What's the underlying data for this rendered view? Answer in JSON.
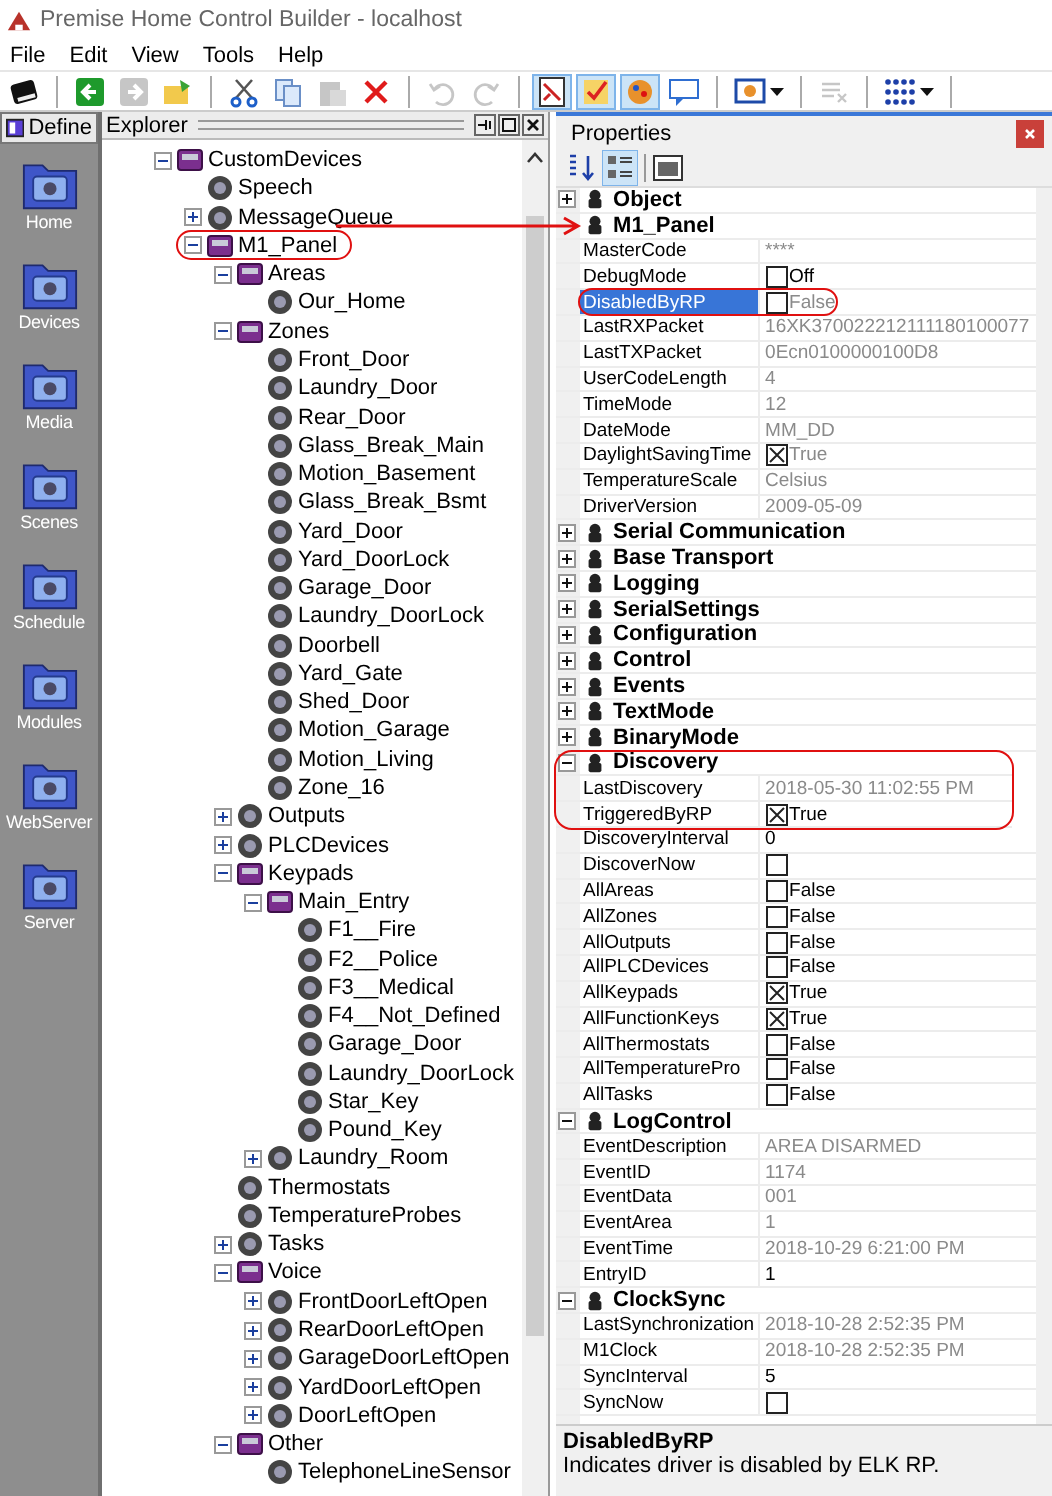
{
  "window": {
    "title": "Premise Home Control Builder - localhost"
  },
  "menu": [
    "File",
    "Edit",
    "View",
    "Tools",
    "Help"
  ],
  "toolbar": [
    {
      "kind": "button",
      "selected": false,
      "disabled": false
    },
    {
      "kind": "separator"
    },
    {
      "kind": "button",
      "selected": false,
      "disabled": false
    },
    {
      "kind": "button",
      "selected": false,
      "disabled": true
    },
    {
      "kind": "button",
      "selected": false,
      "disabled": false
    },
    {
      "kind": "separator"
    },
    {
      "kind": "button",
      "selected": false,
      "disabled": false
    },
    {
      "kind": "button",
      "selected": false,
      "disabled": false
    },
    {
      "kind": "button",
      "selected": false,
      "disabled": true
    },
    {
      "kind": "button",
      "selected": false,
      "disabled": false
    },
    {
      "kind": "separator"
    },
    {
      "kind": "button",
      "selected": false,
      "disabled": true
    },
    {
      "kind": "button",
      "selected": false,
      "disabled": true
    },
    {
      "kind": "separator"
    },
    {
      "kind": "button",
      "selected": true,
      "disabled": false
    },
    {
      "kind": "button",
      "selected": true,
      "disabled": false
    },
    {
      "kind": "button",
      "selected": true,
      "disabled": false
    },
    {
      "kind": "button",
      "selected": false,
      "disabled": false
    },
    {
      "kind": "separator"
    },
    {
      "kind": "dropdown",
      "selected": false,
      "disabled": false
    },
    {
      "kind": "separator"
    },
    {
      "kind": "button",
      "selected": false,
      "disabled": true
    },
    {
      "kind": "separator"
    },
    {
      "kind": "dropdown",
      "selected": false,
      "disabled": false
    },
    {
      "kind": "separator"
    }
  ],
  "sidebar": {
    "tab": "Define",
    "items": [
      "Home",
      "Devices",
      "Media",
      "Scenes",
      "Schedule",
      "Modules",
      "WebServer",
      "Server"
    ]
  },
  "explorer": {
    "title": "Explorer",
    "tree": [
      {
        "label": "CustomDevices",
        "expanded": true,
        "children": [
          {
            "label": "Speech"
          },
          {
            "label": "MessageQueue",
            "expanded": false
          },
          {
            "label": "M1_Panel",
            "expanded": true,
            "circled": true,
            "children": [
              {
                "label": "Areas",
                "expanded": true,
                "children": [
                  {
                    "label": "Our_Home"
                  }
                ]
              },
              {
                "label": "Zones",
                "expanded": true,
                "children": [
                  {
                    "label": "Front_Door"
                  },
                  {
                    "label": "Laundry_Door"
                  },
                  {
                    "label": "Rear_Door"
                  },
                  {
                    "label": "Glass_Break_Main"
                  },
                  {
                    "label": "Motion_Basement"
                  },
                  {
                    "label": "Glass_Break_Bsmt"
                  },
                  {
                    "label": "Yard_Door"
                  },
                  {
                    "label": "Yard_DoorLock"
                  },
                  {
                    "label": "Garage_Door"
                  },
                  {
                    "label": "Laundry_DoorLock"
                  },
                  {
                    "label": "Doorbell"
                  },
                  {
                    "label": "Yard_Gate"
                  },
                  {
                    "label": "Shed_Door"
                  },
                  {
                    "label": "Motion_Garage"
                  },
                  {
                    "label": "Motion_Living"
                  },
                  {
                    "label": "Zone_16"
                  }
                ]
              },
              {
                "label": "Outputs",
                "expanded": false
              },
              {
                "label": "PLCDevices",
                "expanded": false
              },
              {
                "label": "Keypads",
                "expanded": true,
                "children": [
                  {
                    "label": "Main_Entry",
                    "expanded": true,
                    "children": [
                      {
                        "label": "F1__Fire"
                      },
                      {
                        "label": "F2__Police"
                      },
                      {
                        "label": "F3__Medical"
                      },
                      {
                        "label": "F4__Not_Defined"
                      },
                      {
                        "label": "Garage_Door"
                      },
                      {
                        "label": "Laundry_DoorLock"
                      },
                      {
                        "label": "Star_Key"
                      },
                      {
                        "label": "Pound_Key"
                      }
                    ]
                  },
                  {
                    "label": "Laundry_Room",
                    "expanded": false
                  }
                ]
              },
              {
                "label": "Thermostats"
              },
              {
                "label": "TemperatureProbes"
              },
              {
                "label": "Tasks",
                "expanded": false
              },
              {
                "label": "Voice",
                "expanded": true,
                "children": [
                  {
                    "label": "FrontDoorLeftOpen",
                    "expanded": false
                  },
                  {
                    "label": "RearDoorLeftOpen",
                    "expanded": false
                  },
                  {
                    "label": "GarageDoorLeftOpen",
                    "expanded": false
                  },
                  {
                    "label": "YardDoorLeftOpen",
                    "expanded": false
                  },
                  {
                    "label": "DoorLeftOpen",
                    "expanded": false
                  }
                ]
              },
              {
                "label": "Other",
                "expanded": true,
                "children": [
                  {
                    "label": "TelephoneLineSensor"
                  }
                ]
              }
            ]
          }
        ]
      }
    ]
  },
  "properties": {
    "title": "Properties",
    "groups": [
      {
        "name": "Object",
        "expanded": false
      },
      {
        "name": "M1_Panel",
        "rows": [
          {
            "name": "MasterCode",
            "kind": "text",
            "value": "****",
            "readonly": true,
            "selected": false
          },
          {
            "name": "DebugMode",
            "kind": "checkbox",
            "checked": false,
            "value": "Off",
            "readonly": false,
            "selected": false
          },
          {
            "name": "DisabledByRP",
            "kind": "checkbox",
            "checked": false,
            "value": "False",
            "readonly": true,
            "selected": true,
            "circled": true
          },
          {
            "name": "LastRXPacket",
            "kind": "text",
            "value": "16XK370022212111180100077",
            "readonly": true,
            "selected": false
          },
          {
            "name": "LastTXPacket",
            "kind": "text",
            "value": "0Ecn0100000100D8",
            "readonly": true,
            "selected": false
          },
          {
            "name": "UserCodeLength",
            "kind": "text",
            "value": "4",
            "readonly": true,
            "selected": false
          },
          {
            "name": "TimeMode",
            "kind": "text",
            "value": "12",
            "readonly": true,
            "selected": false
          },
          {
            "name": "DateMode",
            "kind": "text",
            "value": "MM_DD",
            "readonly": true,
            "selected": false
          },
          {
            "name": "DaylightSavingTime",
            "kind": "checkbox",
            "checked": true,
            "value": "True",
            "readonly": true,
            "selected": false
          },
          {
            "name": "TemperatureScale",
            "kind": "text",
            "value": "Celsius",
            "readonly": true,
            "selected": false
          },
          {
            "name": "DriverVersion",
            "kind": "text",
            "value": "2009-05-09",
            "readonly": true,
            "selected": false
          }
        ]
      },
      {
        "name": "Serial Communication",
        "expanded": false
      },
      {
        "name": "Base Transport",
        "expanded": false
      },
      {
        "name": "Logging",
        "expanded": false
      },
      {
        "name": "SerialSettings",
        "expanded": false
      },
      {
        "name": "Configuration",
        "expanded": false
      },
      {
        "name": "Control",
        "expanded": false
      },
      {
        "name": "Events",
        "expanded": false
      },
      {
        "name": "TextMode",
        "expanded": false
      },
      {
        "name": "BinaryMode",
        "expanded": false
      },
      {
        "name": "Discovery",
        "expanded": true,
        "circled": true,
        "rows": [
          {
            "name": "LastDiscovery",
            "kind": "text",
            "value": "2018-05-30 11:02:55 PM",
            "readonly": true,
            "selected": false,
            "circled": true
          },
          {
            "name": "TriggeredByRP",
            "kind": "checkbox",
            "checked": true,
            "value": "True",
            "readonly": false,
            "selected": false,
            "circled": true
          },
          {
            "name": "DiscoveryInterval",
            "kind": "text",
            "value": "0",
            "readonly": false,
            "selected": false
          },
          {
            "name": "DiscoverNow",
            "kind": "checkbox",
            "checked": false,
            "readonly": false,
            "selected": false
          },
          {
            "name": "AllAreas",
            "kind": "checkbox",
            "checked": false,
            "value": "False",
            "readonly": false,
            "selected": false
          },
          {
            "name": "AllZones",
            "kind": "checkbox",
            "checked": false,
            "value": "False",
            "readonly": false,
            "selected": false
          },
          {
            "name": "AllOutputs",
            "kind": "checkbox",
            "checked": false,
            "value": "False",
            "readonly": false,
            "selected": false
          },
          {
            "name": "AllPLCDevices",
            "kind": "checkbox",
            "checked": false,
            "value": "False",
            "readonly": false,
            "selected": false
          },
          {
            "name": "AllKeypads",
            "kind": "checkbox",
            "checked": true,
            "value": "True",
            "readonly": false,
            "selected": false
          },
          {
            "name": "AllFunctionKeys",
            "kind": "checkbox",
            "checked": true,
            "value": "True",
            "readonly": false,
            "selected": false
          },
          {
            "name": "AllThermostats",
            "kind": "checkbox",
            "checked": false,
            "value": "False",
            "readonly": false,
            "selected": false
          },
          {
            "name": "AllTemperaturePro",
            "kind": "checkbox",
            "checked": false,
            "value": "False",
            "readonly": false,
            "selected": false
          },
          {
            "name": "AllTasks",
            "kind": "checkbox",
            "checked": false,
            "value": "False",
            "readonly": false,
            "selected": false
          }
        ]
      },
      {
        "name": "LogControl",
        "expanded": true,
        "rows": [
          {
            "name": "EventDescription",
            "kind": "text",
            "value": "AREA DISARMED",
            "readonly": true,
            "selected": false
          },
          {
            "name": "EventID",
            "kind": "text",
            "value": "1174",
            "readonly": true,
            "selected": false
          },
          {
            "name": "EventData",
            "kind": "text",
            "value": "001",
            "readonly": true,
            "selected": false
          },
          {
            "name": "EventArea",
            "kind": "text",
            "value": "1",
            "readonly": true,
            "selected": false
          },
          {
            "name": "EventTime",
            "kind": "text",
            "value": "2018-10-29 6:21:00 PM",
            "readonly": true,
            "selected": false
          },
          {
            "name": "EntryID",
            "kind": "text",
            "value": "1",
            "readonly": false,
            "selected": false
          }
        ]
      },
      {
        "name": "ClockSync",
        "expanded": true,
        "rows": [
          {
            "name": "LastSynchronization",
            "kind": "text",
            "value": "2018-10-28 2:52:35 PM",
            "readonly": true,
            "selected": false
          },
          {
            "name": "M1Clock",
            "kind": "text",
            "value": "2018-10-28 2:52:35 PM",
            "readonly": true,
            "selected": false
          },
          {
            "name": "SyncInterval",
            "kind": "text",
            "value": "5",
            "readonly": false,
            "selected": false
          },
          {
            "name": "SyncNow",
            "kind": "checkbox",
            "checked": false,
            "readonly": false,
            "selected": false
          }
        ]
      }
    ],
    "description": {
      "title": "DisabledByRP",
      "text": "Indicates driver is disabled by ELK RP."
    }
  }
}
